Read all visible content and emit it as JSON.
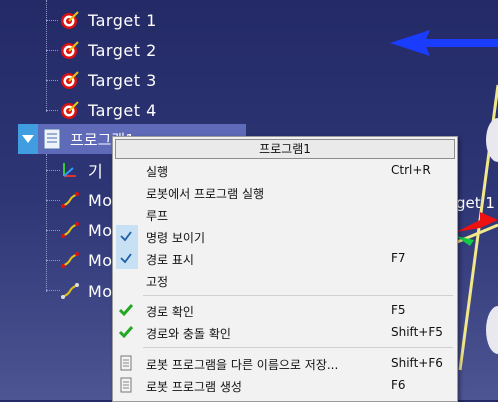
{
  "tree": {
    "targets": [
      "Target 1",
      "Target 2",
      "Target 3",
      "Target 4"
    ],
    "program_label": "프로그램1",
    "children": [
      "기",
      "Mo",
      "Mo",
      "Mo",
      "Mo"
    ]
  },
  "background_label": "get 1",
  "context_menu": {
    "title": "프로그램1",
    "items": [
      {
        "label": "실행",
        "shortcut": "Ctrl+R"
      },
      {
        "label": "로봇에서 프로그램 실행",
        "shortcut": ""
      },
      {
        "label": "루프",
        "shortcut": ""
      },
      {
        "label": "명령 보이기",
        "shortcut": "",
        "checked": true
      },
      {
        "label": "경로 표시",
        "shortcut": "F7",
        "checked": true
      },
      {
        "label": "고정",
        "shortcut": ""
      },
      {
        "label": "경로 확인",
        "shortcut": "F5",
        "icon": "green-check-icon"
      },
      {
        "label": "경로와 충돌 확인",
        "shortcut": "Shift+F5",
        "icon": "green-check-icon"
      },
      {
        "label": "로봇 프로그램을 다른 이름으로 저장...",
        "shortcut": "Shift+F6",
        "icon": "document-icon"
      },
      {
        "label": "로봇 프로그램 생성",
        "shortcut": "F6",
        "icon": "document-icon"
      }
    ]
  },
  "colors": {
    "background_top": "#232a66",
    "selection": "#5f6ab8",
    "expander": "#3f9de0",
    "menu_bg": "#f2f2f2",
    "check_highlight": "#c7e0f4",
    "check_green": "#22a822"
  }
}
